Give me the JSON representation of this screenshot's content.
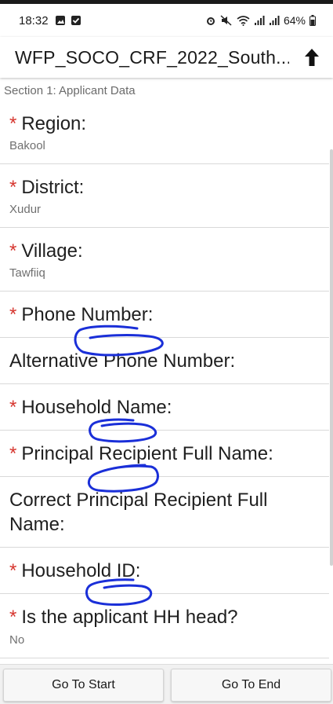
{
  "status_bar": {
    "time": "18:32",
    "battery": "64%",
    "left_icons": [
      "image-icon",
      "check-square-icon"
    ],
    "right_icons": [
      "alarm-icon",
      "mute-icon",
      "wifi-icon",
      "signal-icon",
      "signal-icon",
      "battery-icon"
    ]
  },
  "app_bar": {
    "title": "WFP_SOCO_CRF_2022_South...",
    "action_icon": "upload-arrow-icon"
  },
  "section_title": "Section 1: Applicant Data",
  "questions": [
    {
      "label": "Region:",
      "required": true,
      "value": "Bakool"
    },
    {
      "label": "District:",
      "required": true,
      "value": "Xudur"
    },
    {
      "label": "Village:",
      "required": true,
      "value": "Tawfiiq"
    },
    {
      "label": "Phone Number:",
      "required": true,
      "value": ""
    },
    {
      "label": "Alternative Phone Number:",
      "required": false,
      "value": ""
    },
    {
      "label": "Household Name:",
      "required": true,
      "value": ""
    },
    {
      "label": "Principal Recipient Full Name:",
      "required": true,
      "value": ""
    },
    {
      "label": "Correct Principal Recipient Full Name:",
      "required": false,
      "value": ""
    },
    {
      "label": "Household ID:",
      "required": true,
      "value": ""
    },
    {
      "label": "Is the applicant HH head?",
      "required": true,
      "value": "No"
    }
  ],
  "required_marker": "*",
  "footer": {
    "go_to_start": "Go To Start",
    "go_to_end": "Go To End"
  },
  "colors": {
    "required_star": "#d6362f",
    "scribble": "#1a2fd8",
    "answer_text": "#707070"
  }
}
